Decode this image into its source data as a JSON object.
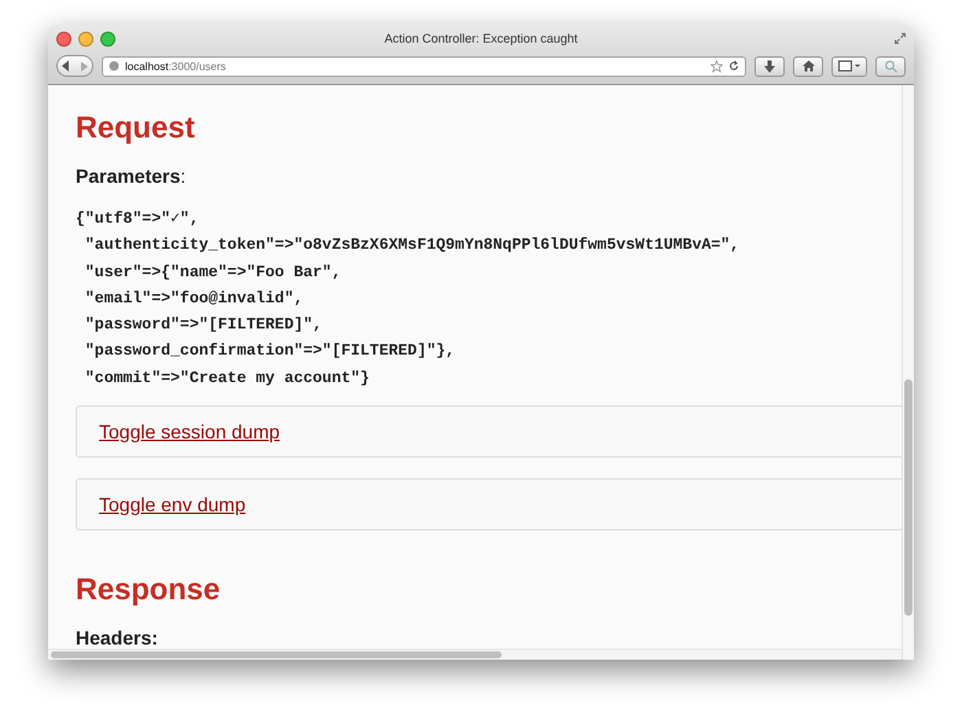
{
  "window": {
    "title": "Action Controller: Exception caught"
  },
  "address_bar": {
    "host": "localhost",
    "path": ":3000/users"
  },
  "request": {
    "heading": "Request",
    "parameters_label": "Parameters",
    "parameters_colon": ":",
    "lines": [
      "{\"utf8\"=>\"✓\",",
      " \"authenticity_token\"=>\"o8vZsBzX6XMsF1Q9mYn8NqPPl6lDUfwm5vsWt1UMBvA=\",",
      " \"user\"=>{\"name\"=>\"Foo Bar\",",
      " \"email\"=>\"foo@invalid\",",
      " \"password\"=>\"[FILTERED]\",",
      " \"password_confirmation\"=>\"[FILTERED]\"},",
      " \"commit\"=>\"Create my account\"}"
    ]
  },
  "toggles": [
    {
      "label": "Toggle session dump"
    },
    {
      "label": "Toggle env dump"
    }
  ],
  "response": {
    "heading": "Response",
    "headers_label": "Headers:"
  }
}
